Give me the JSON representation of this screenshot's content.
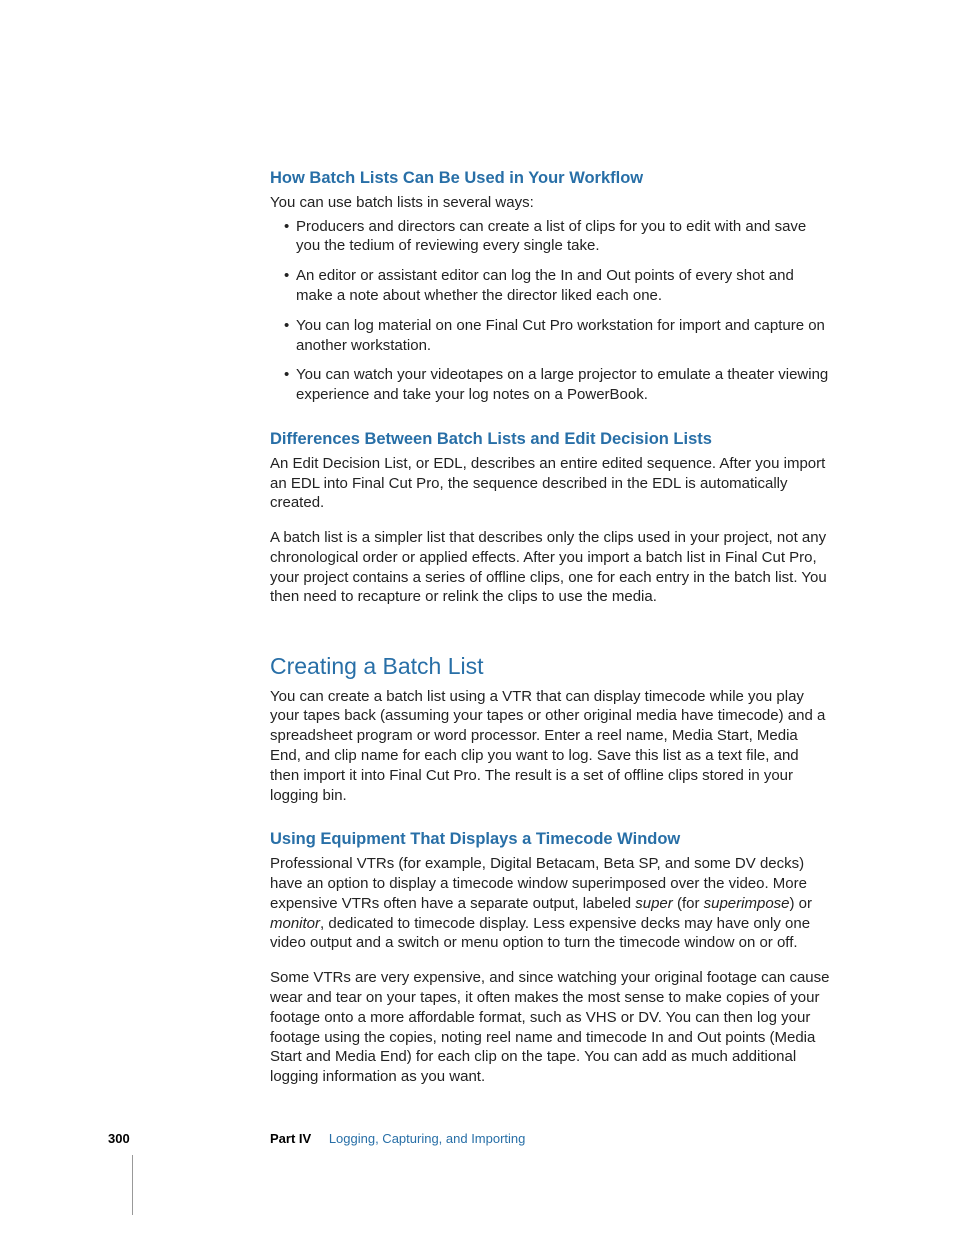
{
  "section1": {
    "heading": "How Batch Lists Can Be Used in Your Workflow",
    "intro": "You can use batch lists in several ways:",
    "bullets": [
      "Producers and directors can create a list of clips for you to edit with and save you the tedium of reviewing every single take.",
      "An editor or assistant editor can log the In and Out points of every shot and make a note about whether the director liked each one.",
      "You can log material on one Final Cut Pro workstation for import and capture on another workstation.",
      "You can watch your videotapes on a large projector to emulate a theater viewing experience and take your log notes on a PowerBook."
    ]
  },
  "section2": {
    "heading": "Differences Between Batch Lists and Edit Decision Lists",
    "p1": "An Edit Decision List, or EDL, describes an entire edited sequence. After you import an EDL into Final Cut Pro, the sequence described in the EDL is automatically created.",
    "p2": "A batch list is a simpler list that describes only the clips used in your project, not any chronological order or applied effects. After you import a batch list in Final Cut Pro, your project contains a series of offline clips, one for each entry in the batch list. You then need to recapture or relink the clips to use the media."
  },
  "section3": {
    "heading": "Creating a Batch List",
    "p1": "You can create a batch list using a VTR that can display timecode while you play your tapes back (assuming your tapes or other original media have timecode) and a spreadsheet program or word processor. Enter a reel name, Media Start, Media End, and clip name for each clip you want to log. Save this list as a text file, and then import it into Final Cut Pro. The result is a set of offline clips stored in your logging bin."
  },
  "section4": {
    "heading": "Using Equipment That Displays a Timecode Window",
    "p1a": "Professional VTRs (for example, Digital Betacam, Beta SP, and some DV decks) have an option to display a timecode window superimposed over the video. More expensive VTRs often have a separate output, labeled ",
    "p1b_i": "super",
    "p1c": " (for ",
    "p1d_i": "superimpose",
    "p1e": ") or ",
    "p1f_i": "monitor",
    "p1g": ", dedicated to timecode display. Less expensive decks may have only one video output and a switch or menu option to turn the timecode window on or off.",
    "p2": "Some VTRs are very expensive, and since watching your original footage can cause wear and tear on your tapes, it often makes the most sense to make copies of your footage onto a more affordable format, such as VHS or DV. You can then log your footage using the copies, noting reel name and timecode In and Out points (Media Start and Media End) for each clip on the tape. You can add as much additional logging information as you want."
  },
  "footer": {
    "page": "300",
    "part": "Part IV",
    "title": "Logging, Capturing, and Importing"
  }
}
